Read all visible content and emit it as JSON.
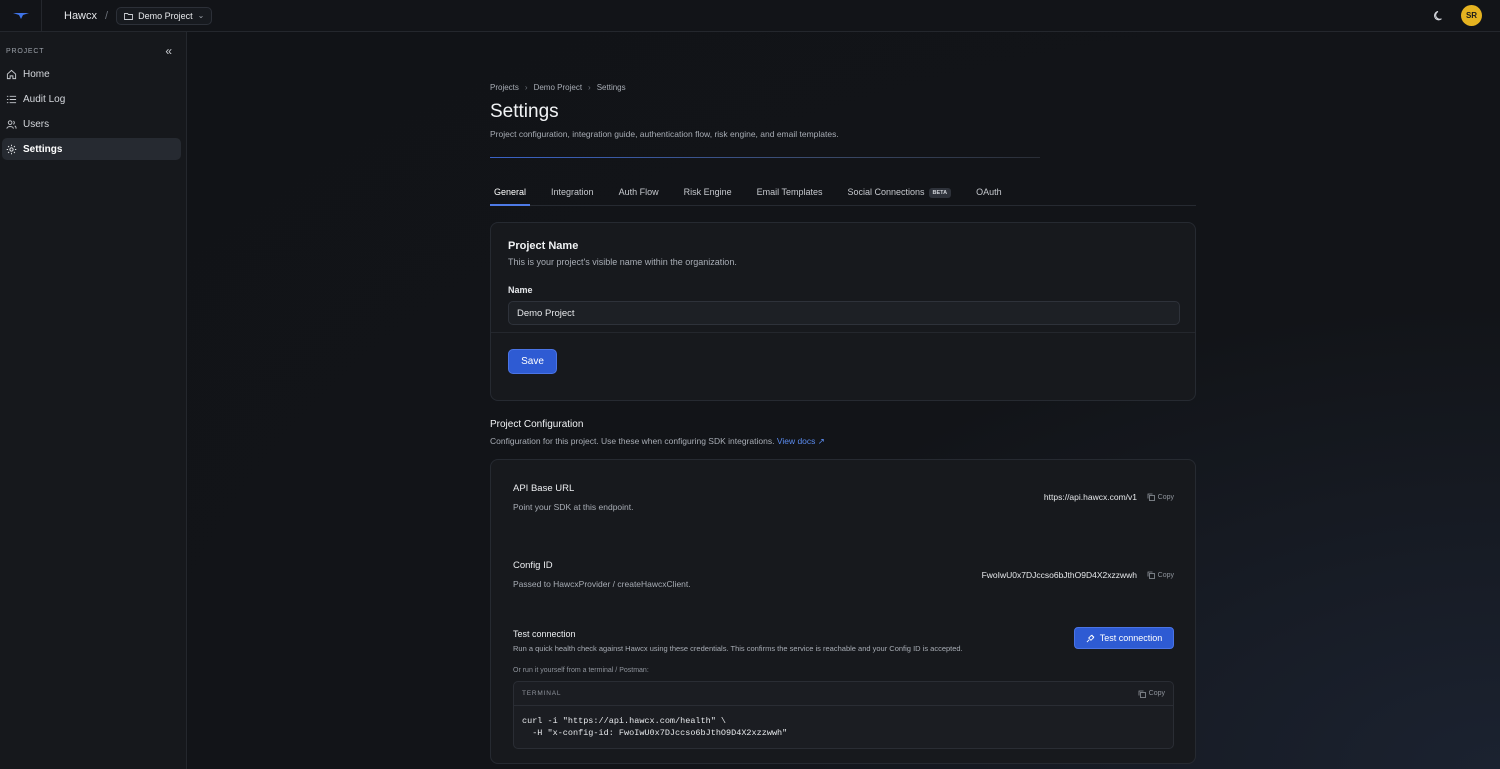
{
  "topbar": {
    "org_name": "Hawcx",
    "separator": "/",
    "project_name": "Demo Project",
    "avatar_initials": "SR"
  },
  "sidebar": {
    "section_label": "PROJECT",
    "items": [
      {
        "label": "Home",
        "icon": "home-icon"
      },
      {
        "label": "Audit Log",
        "icon": "list-icon"
      },
      {
        "label": "Users",
        "icon": "users-icon"
      },
      {
        "label": "Settings",
        "icon": "gear-icon",
        "active": true
      }
    ]
  },
  "breadcrumb": [
    "Projects",
    "Demo Project",
    "Settings"
  ],
  "page": {
    "title": "Settings",
    "subtitle": "Project configuration, integration guide, authentication flow, risk engine, and email templates."
  },
  "tabs": [
    {
      "label": "General",
      "active": true
    },
    {
      "label": "Integration"
    },
    {
      "label": "Auth Flow"
    },
    {
      "label": "Risk Engine"
    },
    {
      "label": "Email Templates"
    },
    {
      "label": "Social Connections",
      "badge": "BETA"
    },
    {
      "label": "OAuth"
    }
  ],
  "project_name_card": {
    "title": "Project Name",
    "description": "This is your project's visible name within the organization.",
    "field_label": "Name",
    "field_value": "Demo Project",
    "save_label": "Save"
  },
  "project_config": {
    "title": "Project Configuration",
    "description": "Configuration for this project. Use these when configuring SDK integrations.",
    "docs_link": "View docs",
    "rows": [
      {
        "title": "API Base URL",
        "description": "Point your SDK at this endpoint.",
        "value": "https://api.hawcx.com/v1",
        "copy": "Copy"
      },
      {
        "title": "Config ID",
        "description": "Passed to HawcxProvider / createHawcxClient.",
        "value": "FwoIwU0x7DJccso6bJthO9D4X2xzzwwh",
        "copy": "Copy"
      }
    ],
    "test": {
      "title": "Test connection",
      "description": "Run a quick health check against Hawcx using these credentials. This confirms the service is reachable and your Config ID is accepted.",
      "button": "Test connection",
      "note": "Or run it yourself from a terminal / Postman:",
      "terminal_label": "TERMINAL",
      "terminal_copy": "Copy",
      "code_line1": "curl -i \"https://api.hawcx.com/health\" \\",
      "code_line2": "  -H \"x-config-id: FwoIwU0x7DJccso6bJthO9D4X2xzzwwh\""
    }
  },
  "colors": {
    "accent": "#2e5bd3",
    "avatar": "#e5b320",
    "link": "#5b8cf0"
  }
}
